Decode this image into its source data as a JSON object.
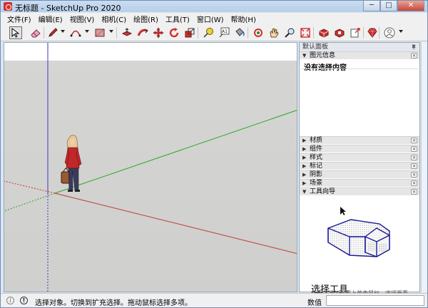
{
  "window": {
    "title": "无标题 - SketchUp Pro 2020",
    "minimize": "─",
    "maximize": "□",
    "close": "✕"
  },
  "menu": [
    "文件(F)",
    "编辑(E)",
    "视图(V)",
    "相机(C)",
    "绘图(R)",
    "工具(T)",
    "窗口(W)",
    "帮助(H)"
  ],
  "toolbar": {
    "icons": [
      "select-arrow-icon",
      "eraser-icon",
      "pencil-line-icon",
      "arc-icon",
      "rectangle-icon",
      "push-pull-icon",
      "follow-me-icon",
      "move-icon",
      "rotate-icon",
      "scale-icon",
      "tape-measure-icon",
      "text-icon",
      "paint-bucket-icon",
      "orbit-icon",
      "pan-icon",
      "zoom-icon",
      "zoom-extents-icon",
      "3d-warehouse-icon",
      "extension-warehouse-icon",
      "layout-send-icon",
      "ruby-extension-icon",
      "user-account-icon"
    ]
  },
  "tray": {
    "title": "默认面板",
    "entity_info": {
      "label": "图元信息",
      "content": "没有选择内容"
    },
    "panels": [
      {
        "label": "材质",
        "arrow": "▶"
      },
      {
        "label": "组件",
        "arrow": "▶"
      },
      {
        "label": "样式",
        "arrow": "▶"
      },
      {
        "label": "标记",
        "arrow": "▶"
      },
      {
        "label": "阴影",
        "arrow": "▶"
      },
      {
        "label": "场景",
        "arrow": "▶"
      },
      {
        "label": "工具向导",
        "arrow": "▼"
      }
    ],
    "instructor": {
      "title": "选择工具",
      "subtitle": "在要选择的元素上单击鼠标，选择要素。"
    }
  },
  "status": {
    "text": "选择对象。切换到扩充选择。拖动鼠标选择多项。",
    "measure_label": "数值",
    "measure_value": ""
  },
  "colors": {
    "sky": "#ffffff",
    "ground": "#d2d2d0",
    "axis_red": "#c0392b",
    "axis_green": "#27a827",
    "axis_blue": "#3a3ac8"
  }
}
